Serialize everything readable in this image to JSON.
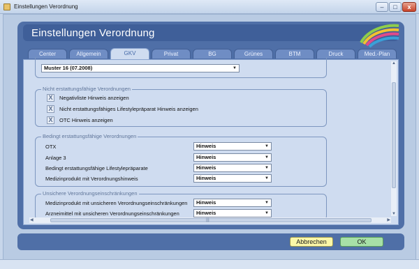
{
  "window": {
    "title": "Einstellungen Verordnung"
  },
  "header": {
    "title": "Einstellungen Verordnung"
  },
  "tabs": [
    {
      "label": "Center"
    },
    {
      "label": "Allgemein"
    },
    {
      "label": "GKV",
      "active": true
    },
    {
      "label": "Privat"
    },
    {
      "label": "BG"
    },
    {
      "label": "Grünes"
    },
    {
      "label": "BTM"
    },
    {
      "label": "Druck"
    },
    {
      "label": "Med.-Plan"
    }
  ],
  "form_select": {
    "value": "Muster 16 (07.2008)"
  },
  "group_nicht": {
    "legend": "Nicht erstattungsfähige Verordnungen",
    "items": [
      {
        "label": "Negativliste Hinweis anzeigen",
        "checked": "X"
      },
      {
        "label": "Nicht erstattungsfähiges Lifestylepräparat Hinweis anzeigen",
        "checked": "X"
      },
      {
        "label": "OTC Hinweis anzeigen",
        "checked": "X"
      }
    ]
  },
  "group_bedingt": {
    "legend": "Bedingt erstattungsfähige Verordnungen",
    "items": [
      {
        "label": "OTX",
        "value": "Hinweis"
      },
      {
        "label": "Anlage 3",
        "value": "Hinweis"
      },
      {
        "label": "Bedingt erstattungsfähige Lifestylepräparate",
        "value": "Hinweis"
      },
      {
        "label": "Medizinprodukt mit Verordnungshinweis",
        "value": "Hinweis"
      }
    ]
  },
  "group_unsicher": {
    "legend": "Unsichere Verordnungseinschränkungen",
    "items": [
      {
        "label": "Medizinprodukt mit unsicheren Verordnungseinschränkungen",
        "value": "Hinweis"
      },
      {
        "label": "Arzneimittel mit unsicheren Verordnungseinschränkungen",
        "value": "Hinweis"
      }
    ]
  },
  "buttons": {
    "cancel": "Abbrechen",
    "ok": "OK"
  },
  "colors": {
    "panel": "#4f6fa7",
    "content": "#cfdcf0",
    "cancel": "#fbf7a8",
    "ok": "#a7e0a7"
  }
}
